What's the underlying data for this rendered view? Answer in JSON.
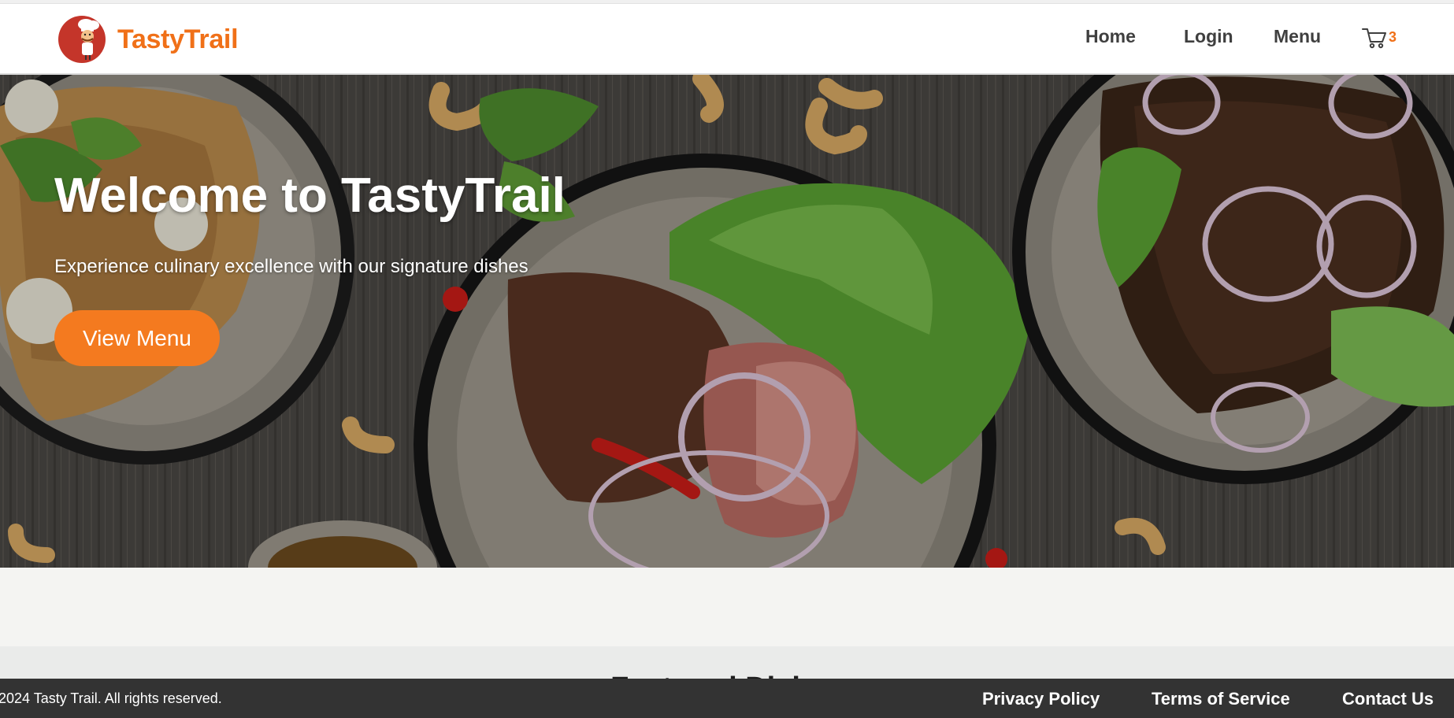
{
  "header": {
    "brand_name": "TastyTrail",
    "logo_icon": "chef-mascot-icon",
    "nav": {
      "home": "Home",
      "login": "Login",
      "menu": "Menu"
    },
    "cart": {
      "icon": "shopping-cart-icon",
      "count": "3"
    }
  },
  "hero": {
    "title": "Welcome to TastyTrail",
    "subtitle": "Experience culinary excellence with our signature dishes",
    "cta_label": "View Menu"
  },
  "featured": {
    "heading": "Featured Dishes"
  },
  "footer": {
    "copyright": "2024 Tasty Trail. All rights reserved.",
    "links": {
      "privacy": "Privacy Policy",
      "terms": "Terms of Service",
      "contact": "Contact Us"
    }
  },
  "colors": {
    "brand": "#f07018",
    "cta": "#f47a1f",
    "footer_bg": "#333333",
    "nav_text": "#3f3f3f"
  }
}
